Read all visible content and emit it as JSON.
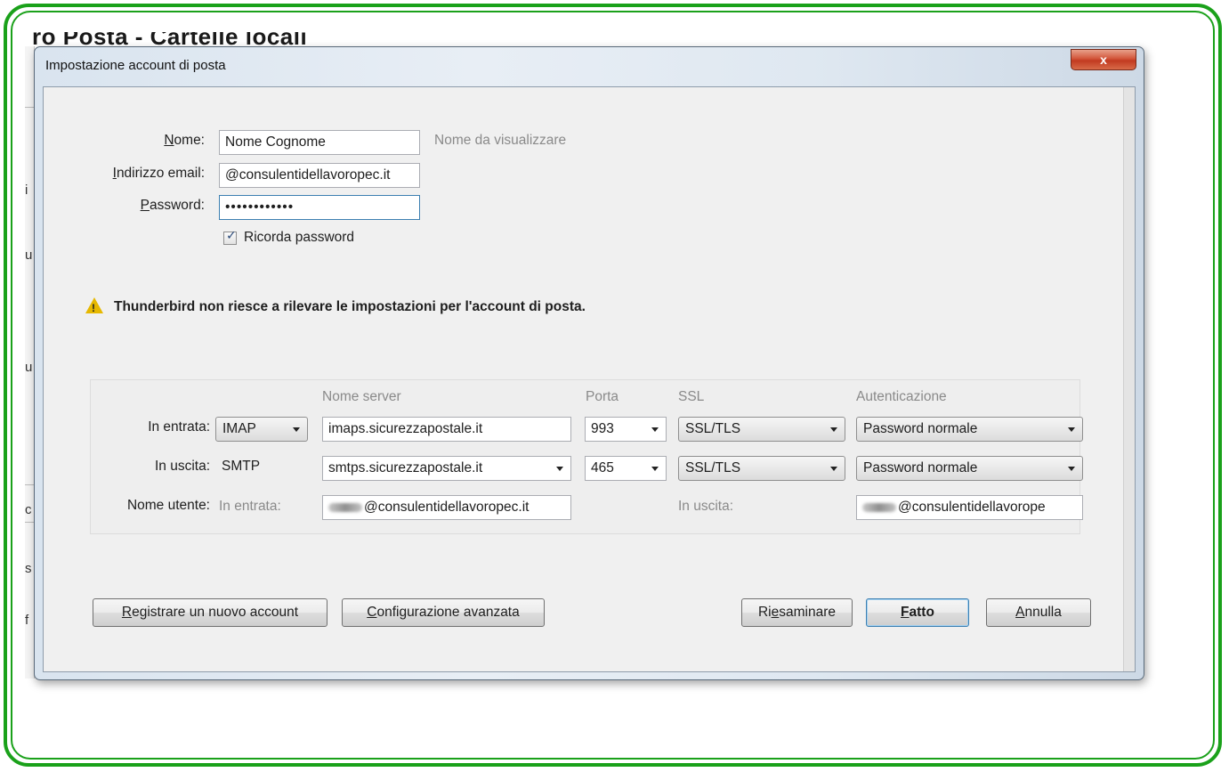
{
  "background": {
    "title": "ro Posta - Cartelle locali",
    "side_letters": [
      "i",
      "u",
      "u",
      "c",
      "s",
      "f"
    ]
  },
  "window": {
    "title": "Impostazione account di posta",
    "close_label": "x"
  },
  "identity": {
    "name_label": "Nome:",
    "name_value": "Nome Cognome",
    "name_hint": "Nome da visualizzare",
    "email_label": "Indirizzo email:",
    "email_value": "@consulentidellavoropec.it",
    "password_label": "Password:",
    "password_value": "••••••••••••",
    "remember_label": "Ricorda password",
    "remember_checked": true
  },
  "warning": {
    "icon": "warning-icon",
    "text": "Thunderbird non riesce a rilevare le impostazioni per l'account di posta."
  },
  "server_table": {
    "headers": {
      "server": "Nome server",
      "port": "Porta",
      "ssl": "SSL",
      "auth": "Autenticazione"
    },
    "incoming": {
      "label": "In entrata:",
      "protocol": "IMAP",
      "server": "imaps.sicurezzapostale.it",
      "port": "993",
      "ssl": "SSL/TLS",
      "auth": "Password normale"
    },
    "outgoing": {
      "label": "In uscita:",
      "protocol": "SMTP",
      "server": "smtps.sicurezzapostale.it",
      "port": "465",
      "ssl": "SSL/TLS",
      "auth": "Password normale"
    },
    "username": {
      "label": "Nome utente:",
      "incoming_label": "In entrata:",
      "incoming_value": "@consulentidellavoropec.it",
      "outgoing_label": "In uscita:",
      "outgoing_value": "@consulentidellavorope"
    }
  },
  "buttons": {
    "register": "Registrare un nuovo account",
    "advanced": "Configurazione avanzata",
    "retest": "Riesaminare",
    "done": "Fatto",
    "cancel": "Annulla"
  },
  "colors": {
    "frame": "#1aa11a",
    "close_button": "#c23a20",
    "warning": "#e6b800"
  }
}
